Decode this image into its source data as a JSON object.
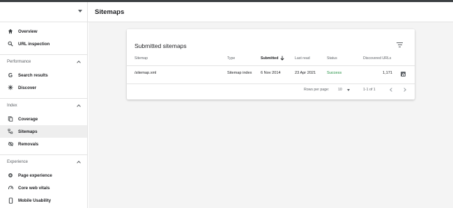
{
  "header": {
    "title": "Sitemaps"
  },
  "sidebar": {
    "top_items": [
      {
        "label": "Overview",
        "icon": "home-icon"
      },
      {
        "label": "URL inspection",
        "icon": "search-icon"
      }
    ],
    "sections": [
      {
        "title": "Performance",
        "items": [
          {
            "label": "Search results",
            "icon": "google-g-icon"
          },
          {
            "label": "Discover",
            "icon": "asterisk-icon"
          }
        ]
      },
      {
        "title": "Index",
        "items": [
          {
            "label": "Coverage",
            "icon": "coverage-icon"
          },
          {
            "label": "Sitemaps",
            "icon": "sitemap-icon",
            "active": true
          },
          {
            "label": "Removals",
            "icon": "eye-off-icon"
          }
        ]
      },
      {
        "title": "Experience",
        "items": [
          {
            "label": "Page experience",
            "icon": "gear-plus-icon"
          },
          {
            "label": "Core web vitals",
            "icon": "speedometer-icon"
          },
          {
            "label": "Mobile Usability",
            "icon": "phone-icon"
          }
        ]
      }
    ]
  },
  "card": {
    "title": "Submitted sitemaps",
    "columns": {
      "sitemap": "Sitemap",
      "type": "Type",
      "submitted": "Submitted",
      "last_read": "Last read",
      "status": "Status",
      "discovered": "Discovered URLs"
    },
    "rows": [
      {
        "sitemap": "/sitemap.xml",
        "type": "Sitemap index",
        "submitted": "6 Nov 2014",
        "last_read": "23 Apr 2021",
        "status": "Success",
        "discovered": "1,171"
      }
    ],
    "pagination": {
      "rows_per_page_label": "Rows per page:",
      "rows_per_page_value": "10",
      "range": "1-1 of 1"
    }
  },
  "colors": {
    "success": "#1e8e3e",
    "active_bg": "#eeeeee",
    "main_bg": "#f4f4f4"
  }
}
